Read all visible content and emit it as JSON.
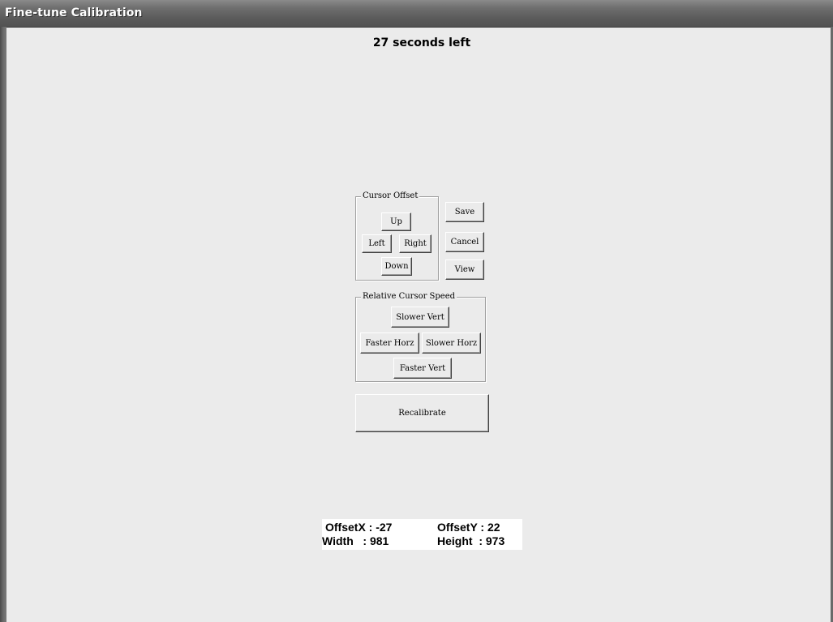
{
  "window": {
    "title": "Fine-tune Calibration"
  },
  "timer": {
    "text": "27 seconds left"
  },
  "cursor_offset": {
    "label": "Cursor Offset",
    "up": "Up",
    "left": "Left",
    "right": "Right",
    "down": "Down"
  },
  "actions": {
    "save": "Save",
    "cancel": "Cancel",
    "view": "View"
  },
  "cursor_speed": {
    "label": "Relative Cursor Speed",
    "slower_vert": "Slower Vert",
    "faster_horz": "Faster Horz",
    "slower_horz": "Slower Horz",
    "faster_vert": "Faster Vert"
  },
  "recalibrate": {
    "label": "Recalibrate"
  },
  "info": {
    "offset_x": "OffsetX : -27",
    "offset_y": "OffsetY : 22",
    "width": "Width   : 981",
    "height": "Height  : 973"
  }
}
